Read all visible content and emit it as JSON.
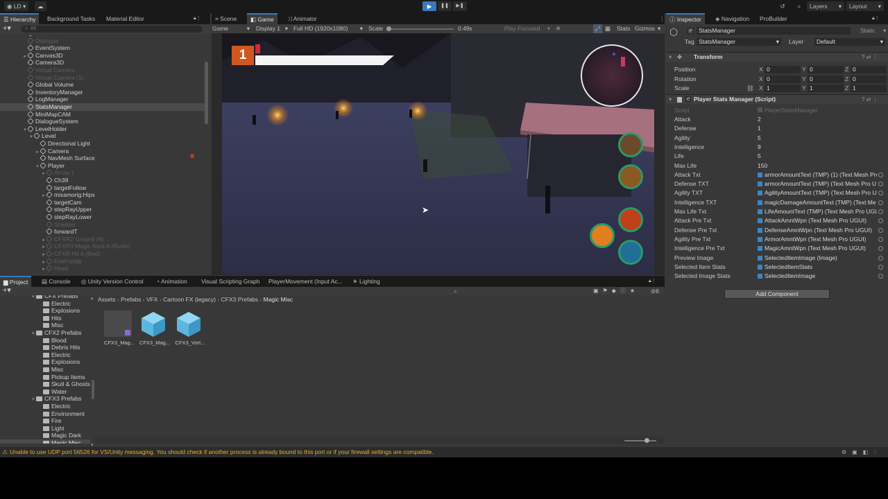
{
  "toolbar": {
    "account": "LD",
    "layers": "Layers",
    "layout": "Layout",
    "play": "▶",
    "pause": "❚❚",
    "step": "▶❚"
  },
  "hierarchy": {
    "tabs": [
      "Hierarchy",
      "Background Tasks",
      "Material Editor"
    ],
    "search_placeholder": "All",
    "rows": [
      {
        "t": "AttackPanel",
        "d": 0,
        "s": ""
      },
      {
        "t": "Dialogue",
        "d": 0,
        "s": "dim"
      },
      {
        "t": "EventSystem",
        "d": 0,
        "s": ""
      },
      {
        "t": "Canvas3D",
        "d": 0,
        "s": "",
        "e": "r"
      },
      {
        "t": "Camera3D",
        "d": 0,
        "s": ""
      },
      {
        "t": "Virtual Camera",
        "d": 0,
        "s": "dim"
      },
      {
        "t": "Virtual Camera (1)",
        "d": 0,
        "s": "dim"
      },
      {
        "t": "Global Volume",
        "d": 0,
        "s": ""
      },
      {
        "t": "InventoryManager",
        "d": 0,
        "s": ""
      },
      {
        "t": "LogManager",
        "d": 0,
        "s": ""
      },
      {
        "t": "StatsManager",
        "d": 0,
        "s": "sel"
      },
      {
        "t": "MiniMapCAM",
        "d": 0,
        "s": ""
      },
      {
        "t": "DialogueSystem",
        "d": 0,
        "s": ""
      },
      {
        "t": "LevelHolder",
        "d": 0,
        "s": "",
        "e": "d"
      },
      {
        "t": "Level",
        "d": 1,
        "s": "",
        "e": "d"
      },
      {
        "t": "Directional Light",
        "d": 2,
        "s": ""
      },
      {
        "t": "Camera",
        "d": 2,
        "s": "",
        "e": "r"
      },
      {
        "t": "NavMesh Surface",
        "d": 2,
        "s": ""
      },
      {
        "t": "Player",
        "d": 2,
        "s": "",
        "e": "d"
      },
      {
        "t": "Arrow 1",
        "d": 3,
        "s": "dim",
        "e": "r"
      },
      {
        "t": "Ch39",
        "d": 3,
        "s": ""
      },
      {
        "t": "targetFollow",
        "d": 3,
        "s": ""
      },
      {
        "t": "mixamorig:Hips",
        "d": 3,
        "s": "",
        "e": "r"
      },
      {
        "t": "targetCam",
        "d": 3,
        "s": ""
      },
      {
        "t": "stepRayUpper",
        "d": 3,
        "s": ""
      },
      {
        "t": "stepRayLower",
        "d": 3,
        "s": ""
      },
      {
        "t": "Shielder",
        "d": 3,
        "s": "dim"
      },
      {
        "t": "forwardT",
        "d": 3,
        "s": ""
      },
      {
        "t": "CFXR2 Ground Hit",
        "d": 3,
        "s": "dim",
        "e": "r"
      },
      {
        "t": "CFXR3 Magic Aura A (Runic)",
        "d": 3,
        "s": "dim",
        "e": "r"
      },
      {
        "t": "CFXR Hit A (Red)",
        "d": 3,
        "s": "dim",
        "e": "r"
      },
      {
        "t": "FirePrefab",
        "d": 3,
        "s": "dim",
        "e": "r"
      },
      {
        "t": "Head",
        "d": 3,
        "s": "dim",
        "e": "r"
      }
    ]
  },
  "game": {
    "tabs": [
      "Scene",
      "Game",
      "Animator"
    ],
    "mode": "Game",
    "display": "Display 1",
    "resolution": "Full HD (1920x1080)",
    "scale_label": "Scale",
    "scale_value": "0.49x",
    "play_focused": "Play Focused",
    "stats": "Stats",
    "gizmos": "Gizmos",
    "hud_level": "1",
    "health_fraction": 0.95
  },
  "inspector": {
    "tabs": [
      "Inspector",
      "Navigation",
      "ProBuilder"
    ],
    "object_name": "StatsManager",
    "static_label": "Static",
    "tag_label": "Tag",
    "tag_value": "StatsManager",
    "layer_label": "Layer",
    "layer_value": "Default",
    "transform": {
      "title": "Transform",
      "rows": [
        {
          "label": "Position",
          "x": "0",
          "y": "0",
          "z": "0"
        },
        {
          "label": "Rotation",
          "x": "0",
          "y": "0",
          "z": "0"
        },
        {
          "label": "Scale",
          "x": "1",
          "y": "1",
          "z": "1"
        }
      ]
    },
    "script": {
      "title": "Player Stats Manager (Script)",
      "script_label": "Script",
      "script_value": "PlayerStatsManager",
      "fields": [
        {
          "label": "Attack",
          "value": "2",
          "ref": false
        },
        {
          "label": "Defense",
          "value": "1",
          "ref": false
        },
        {
          "label": "Agility",
          "value": "5",
          "ref": false
        },
        {
          "label": "Intelligence",
          "value": "9",
          "ref": false
        },
        {
          "label": "Life",
          "value": "5",
          "ref": false
        },
        {
          "label": "Max Life",
          "value": "150",
          "ref": false
        },
        {
          "label": "Attack Txt",
          "value": "armorAmountText (TMP) (1) (Text Mesh Pro",
          "ref": true
        },
        {
          "label": "Defense TXT",
          "value": "armorAmountText (TMP) (Text Mesh Pro U",
          "ref": true
        },
        {
          "label": "Agility TXT",
          "value": "AgilityAmountText (TMP) (Text Mesh Pro U",
          "ref": true
        },
        {
          "label": "Intelligence TXT",
          "value": "magicDamageAmountText (TMP) (Text Me",
          "ref": true
        },
        {
          "label": "Max Life Txt",
          "value": "LifeAmountText (TMP) (Text Mesh Pro UGU",
          "ref": true
        },
        {
          "label": "Attack Pre Txt",
          "value": "AttackAmntWpn (Text Mesh Pro UGUI)",
          "ref": true
        },
        {
          "label": "Defense Pre Txt",
          "value": "DefenseAmntWpn (Text Mesh Pro UGUI)",
          "ref": true
        },
        {
          "label": "Agility Pre Txt",
          "value": "ArmorAmntWpn (Text Mesh Pro UGUI)",
          "ref": true
        },
        {
          "label": "Intelligence Pre Txt",
          "value": "MagicAmntWpn (Text Mesh Pro UGUI)",
          "ref": true
        },
        {
          "label": "Preview Image",
          "value": "SelectedItemImage (Image)",
          "ref": true
        },
        {
          "label": "Selected Item Stats",
          "value": "SelectedItemStats",
          "ref": true
        },
        {
          "label": "Selected Image Stats",
          "value": "SelectedItemImage",
          "ref": true
        }
      ]
    },
    "add_component": "Add Component"
  },
  "project": {
    "tabs": [
      "Project",
      "Console",
      "Unity Version Control",
      "Animation",
      "Visual Scripting Graph",
      "PlayerMovement (Input Ac...",
      "Lighting"
    ],
    "breadcrumb": [
      "Assets",
      "Prefabs",
      "VFX",
      "Cartoon FX (legacy)",
      "CFX3 Prefabs",
      "Magic Misc"
    ],
    "tree": [
      {
        "t": "CFX Prefabs",
        "d": 0,
        "e": "d"
      },
      {
        "t": "Electric",
        "d": 1
      },
      {
        "t": "Explosions",
        "d": 1
      },
      {
        "t": "Hits",
        "d": 1
      },
      {
        "t": "Misc",
        "d": 1
      },
      {
        "t": "CFX2 Prefabs",
        "d": 0,
        "e": "d"
      },
      {
        "t": "Blood",
        "d": 1
      },
      {
        "t": "Debris Hits",
        "d": 1
      },
      {
        "t": "Electric",
        "d": 1
      },
      {
        "t": "Explosions",
        "d": 1
      },
      {
        "t": "Misc",
        "d": 1
      },
      {
        "t": "Pickup Items",
        "d": 1
      },
      {
        "t": "Skull & Ghosts E",
        "d": 1
      },
      {
        "t": "Water",
        "d": 1
      },
      {
        "t": "CFX3 Prefabs",
        "d": 0,
        "e": "d"
      },
      {
        "t": "Electric",
        "d": 1
      },
      {
        "t": "Environment",
        "d": 1
      },
      {
        "t": "Fire",
        "d": 1
      },
      {
        "t": "Light",
        "d": 1
      },
      {
        "t": "Magic Dark",
        "d": 1
      },
      {
        "t": "Magic Misc",
        "d": 1,
        "sel": true
      }
    ],
    "assets": [
      {
        "label": "CFX3_Mag...",
        "kind": "prefab-variant"
      },
      {
        "label": "CFX3_Mag...",
        "kind": "prefab"
      },
      {
        "label": "CFX3_Vort...",
        "kind": "prefab"
      }
    ],
    "badge_count": "8"
  },
  "status": {
    "warning": "Unable to use UDP port 56526 for VS/Unity messaging. You should check if another process is already bound to this port or if your firewall settings are compatible."
  },
  "colors": {
    "accent": "#3a79bb",
    "warning": "#e8b023",
    "selection": "#4b4b4b"
  }
}
